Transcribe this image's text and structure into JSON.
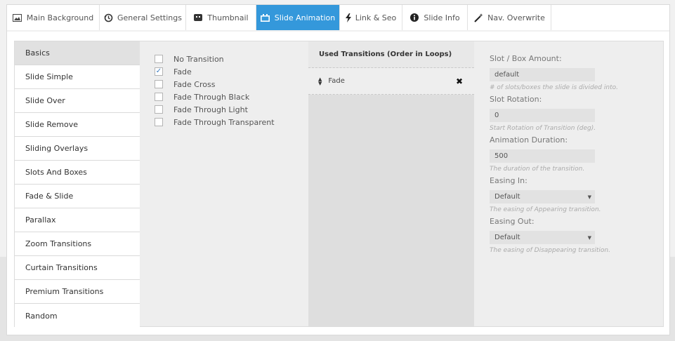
{
  "tabs": [
    {
      "label": "Main Background",
      "icon": "image-icon"
    },
    {
      "label": "General Settings",
      "icon": "history-icon"
    },
    {
      "label": "Thumbnail",
      "icon": "thumbnail-icon"
    },
    {
      "label": "Slide Animation",
      "icon": "slide-animation-icon",
      "active": true
    },
    {
      "label": "Link & Seo",
      "icon": "bolt-icon"
    },
    {
      "label": "Slide Info",
      "icon": "info-icon"
    },
    {
      "label": "Nav. Overwrite",
      "icon": "magic-wand-icon"
    }
  ],
  "sidebar": {
    "items": [
      {
        "label": "Basics",
        "active": true
      },
      {
        "label": "Slide Simple"
      },
      {
        "label": "Slide Over"
      },
      {
        "label": "Slide Remove"
      },
      {
        "label": "Sliding Overlays"
      },
      {
        "label": "Slots And Boxes"
      },
      {
        "label": "Fade & Slide"
      },
      {
        "label": "Parallax"
      },
      {
        "label": "Zoom Transitions"
      },
      {
        "label": "Curtain Transitions"
      },
      {
        "label": "Premium Transitions"
      },
      {
        "label": "Random"
      }
    ]
  },
  "transitions": [
    {
      "label": "No Transition",
      "checked": false
    },
    {
      "label": "Fade",
      "checked": true
    },
    {
      "label": "Fade Cross",
      "checked": false
    },
    {
      "label": "Fade Through Black",
      "checked": false
    },
    {
      "label": "Fade Through Light",
      "checked": false
    },
    {
      "label": "Fade Through Transparent",
      "checked": false
    }
  ],
  "used": {
    "title": "Used Transitions (Order in Loops)",
    "items": [
      "Fade"
    ]
  },
  "params": {
    "slot_amount": {
      "label": "Slot / Box Amount:",
      "value": "default",
      "hint": "# of slots/boxes the slide is divided into."
    },
    "slot_rotation": {
      "label": "Slot Rotation:",
      "value": "0",
      "hint": "Start Rotation of Transition (deg)."
    },
    "duration": {
      "label": "Animation Duration:",
      "value": "500",
      "hint": "The duration of the transition."
    },
    "easing_in": {
      "label": "Easing In:",
      "value": "Default",
      "hint": "The easing of Appearing transition."
    },
    "easing_out": {
      "label": "Easing Out:",
      "value": "Default",
      "hint": "The easing of Disappearing transition."
    }
  },
  "colors": {
    "accent": "#3498db"
  }
}
